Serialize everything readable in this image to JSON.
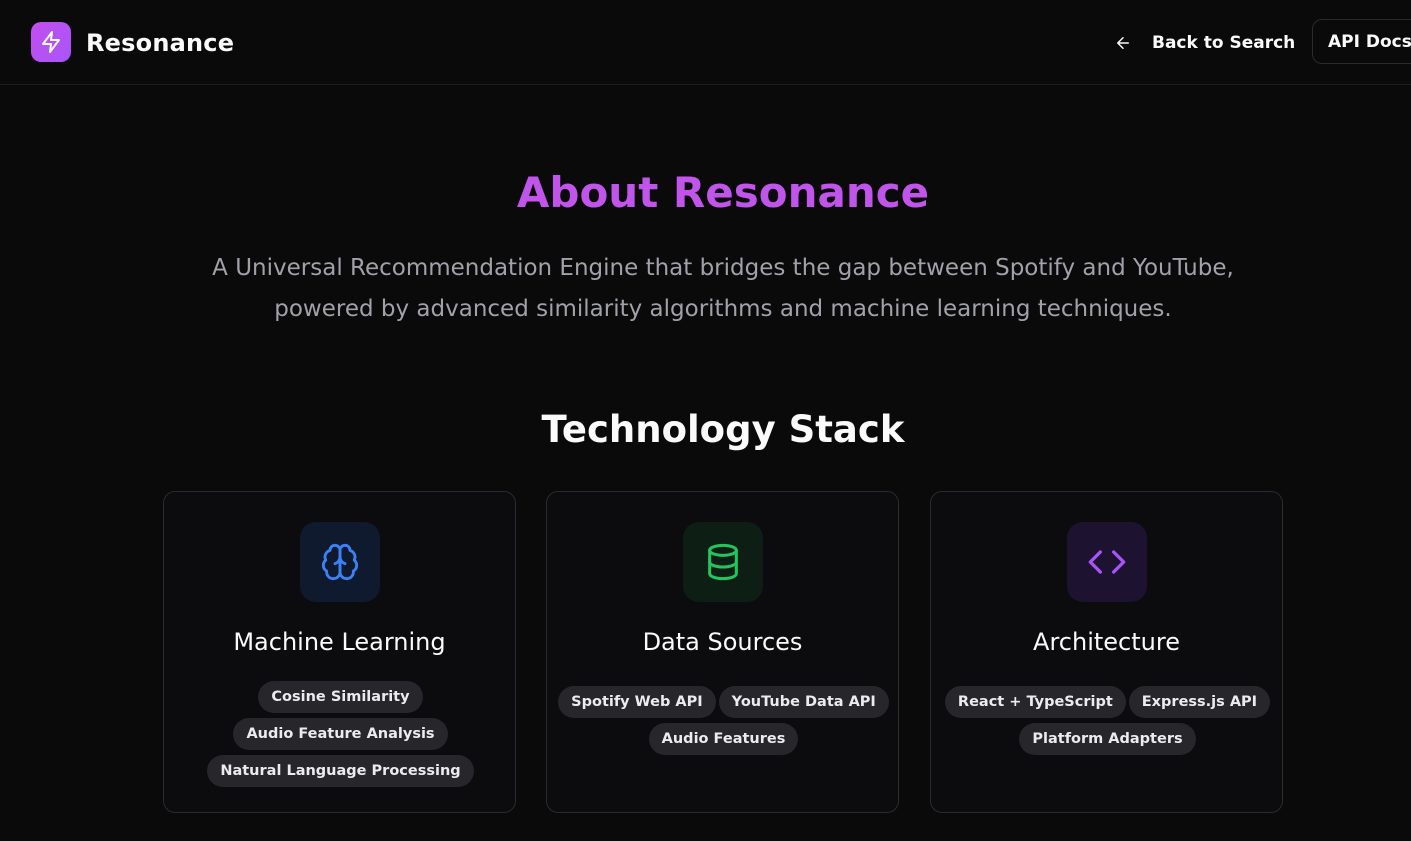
{
  "header": {
    "brand": "Resonance",
    "logo_icon": "lightning-bolt-icon",
    "back_label": "Back to Search",
    "back_icon": "arrow-left-icon",
    "api_docs_label": "API Docs"
  },
  "hero": {
    "title": "About Resonance",
    "description": "A Universal Recommendation Engine that bridges the gap between Spotify and YouTube, powered by advanced similarity algorithms and machine learning techniques."
  },
  "tech_stack": {
    "title": "Technology Stack",
    "cards": [
      {
        "title": "Machine Learning",
        "icon": "brain-icon",
        "color": "#3b82f6",
        "tags": [
          "Cosine Similarity",
          "Audio Feature Analysis",
          "Natural Language Processing"
        ]
      },
      {
        "title": "Data Sources",
        "icon": "database-icon",
        "color": "#22c55e",
        "tags": [
          "Spotify Web API",
          "YouTube Data API",
          "Audio Features"
        ]
      },
      {
        "title": "Architecture",
        "icon": "code-icon",
        "color": "#a855f7",
        "tags": [
          "React + TypeScript",
          "Express.js API",
          "Platform Adapters"
        ]
      }
    ]
  },
  "colors": {
    "accent": "#c155eb",
    "background": "#0a0a0b"
  }
}
